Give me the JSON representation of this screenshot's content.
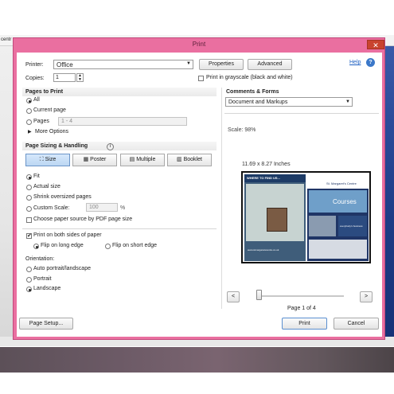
{
  "background": {
    "address_fragment": "centr"
  },
  "dialog": {
    "title": "Print",
    "close_glyph": "✕",
    "help_label": "Help",
    "help_icon_glyph": "?",
    "printer_label": "Printer:",
    "printer_value": "Office",
    "properties_label": "Properties",
    "advanced_label": "Advanced",
    "copies_label": "Copies:",
    "copies_value": "1",
    "grayscale_label": "Print in grayscale (black and white)",
    "grayscale_checked": false
  },
  "pages_to_print": {
    "heading": "Pages to Print",
    "all_label": "All",
    "current_label": "Current page",
    "pages_label": "Pages",
    "pages_value": "1 - 4",
    "more_options_label": "More Options",
    "selected": "All"
  },
  "sizing": {
    "heading": "Page Sizing & Handling",
    "info_glyph": "i",
    "tabs": [
      {
        "label": "Size",
        "active": true
      },
      {
        "label": "Poster",
        "active": false
      },
      {
        "label": "Multiple",
        "active": false
      },
      {
        "label": "Booklet",
        "active": false
      }
    ],
    "fit_label": "Fit",
    "actual_label": "Actual size",
    "shrink_label": "Shrink oversized pages",
    "custom_label": "Custom Scale:",
    "custom_value": "100",
    "percent_label": "%",
    "choose_source_label": "Choose paper source by PDF page size",
    "selected": "Fit"
  },
  "duplex": {
    "both_sides_label": "Print on both sides of paper",
    "both_sides_checked": true,
    "flip_long_label": "Flip on long edge",
    "flip_short_label": "Flip on short edge",
    "selected": "Flip on long edge"
  },
  "orientation": {
    "heading": "Orientation:",
    "auto_label": "Auto portrait/landscape",
    "portrait_label": "Portrait",
    "landscape_label": "Landscape",
    "selected": "Landscape"
  },
  "comments": {
    "heading": "Comments & Forms",
    "value": "Document and Markups",
    "scale_text": "Scale: 98%",
    "page_size_text": "11.69 x 8.27 Inches",
    "page_indicator": "Page 1 of 4",
    "prev_glyph": "<",
    "next_glyph": ">",
    "slider_position_fraction": 0.0
  },
  "preview": {
    "left_banner": "WHERE TO FIND US...",
    "right_brand": "St. Margaret's Centre",
    "courses_label": "Courses",
    "right_tagline": "everybody's business",
    "url_text": "www.stmargaretscentre.co.uk",
    "colors": {
      "left_bg": "#3f5d7a",
      "right_bg": "#1f3566",
      "map": "#c7d3d1"
    }
  },
  "footer": {
    "page_setup_label": "Page Setup...",
    "print_label": "Print",
    "cancel_label": "Cancel"
  },
  "accent_color": "#ea6fa0"
}
